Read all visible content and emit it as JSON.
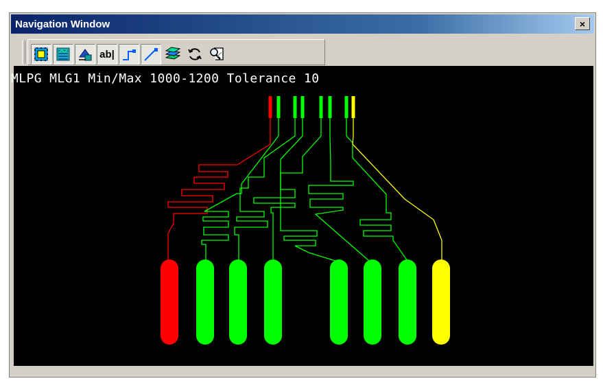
{
  "window": {
    "title": "Navigation Window",
    "close_label": "×"
  },
  "toolbar": {
    "buttons": [
      {
        "name": "select-icon",
        "pressed": true
      },
      {
        "name": "layers-panel-icon",
        "pressed": true
      },
      {
        "name": "fill-bucket-icon",
        "pressed": true
      },
      {
        "name": "text-icon",
        "label": "ab|",
        "pressed": true
      },
      {
        "name": "route-corner-icon",
        "pressed": true
      },
      {
        "name": "route-diagonal-icon",
        "pressed": true
      },
      {
        "name": "layer-stack-icon",
        "pressed": false
      },
      {
        "name": "refresh-icon",
        "pressed": false
      },
      {
        "name": "zoom-fit-icon",
        "pressed": false
      }
    ]
  },
  "canvas": {
    "status": "MLPG MLG1 Min/Max 1000-1200 Tolerance 10",
    "colors": {
      "background": "#000000",
      "too_short": "#ff0000",
      "ok": "#00ff00",
      "warn": "#ffff00"
    },
    "nets": [
      {
        "id": "net-1",
        "status": "too_short"
      },
      {
        "id": "net-2",
        "status": "ok"
      },
      {
        "id": "net-3",
        "status": "ok"
      },
      {
        "id": "net-4",
        "status": "ok"
      },
      {
        "id": "net-5",
        "status": "ok"
      },
      {
        "id": "net-6",
        "status": "ok"
      },
      {
        "id": "net-7",
        "status": "ok"
      },
      {
        "id": "net-8",
        "status": "warn"
      }
    ]
  }
}
